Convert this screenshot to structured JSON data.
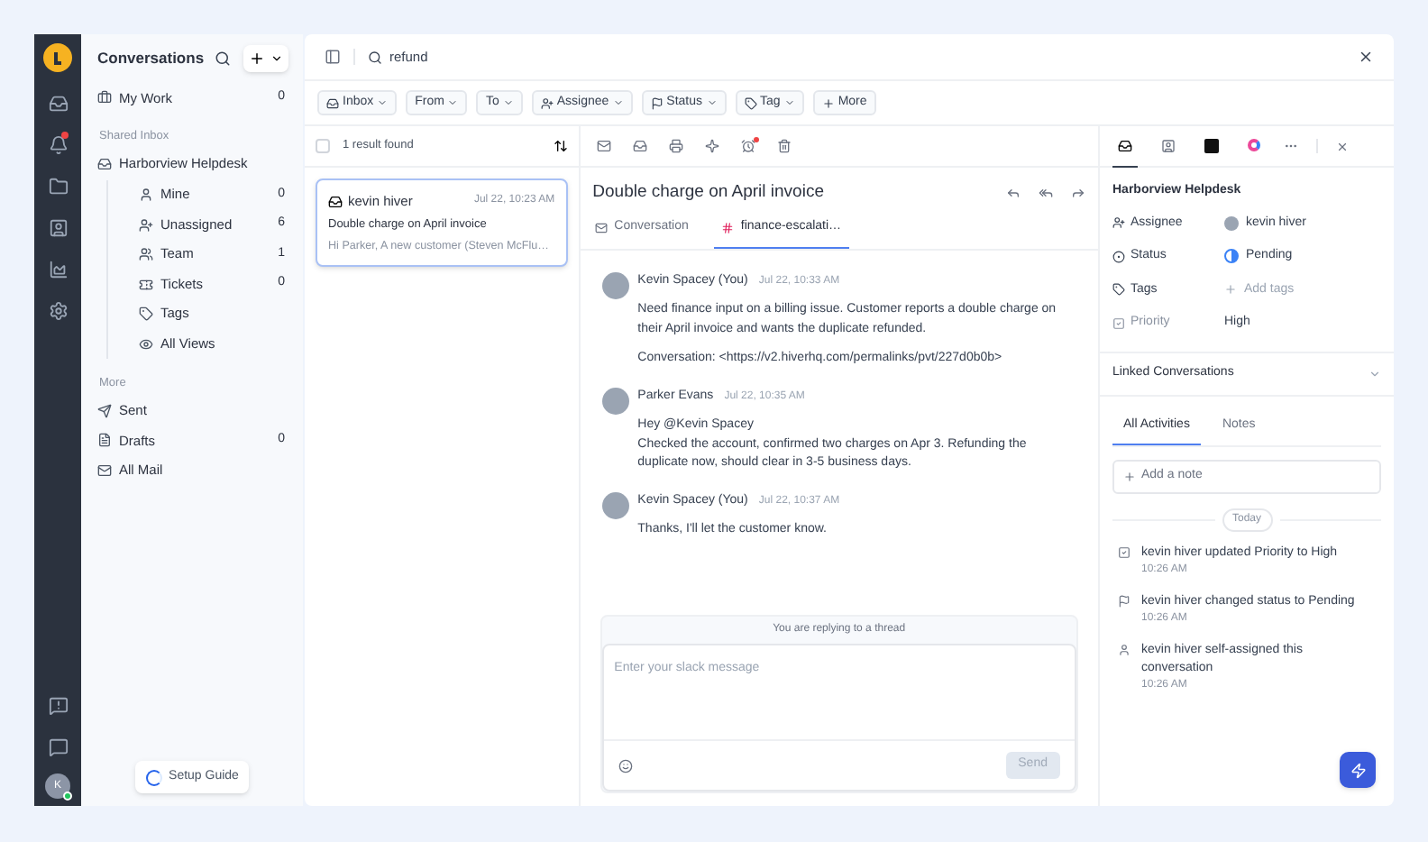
{
  "rail": {
    "top": [
      {
        "kind": "inbox",
        "alert": false
      },
      {
        "kind": "bell",
        "alert": true
      },
      {
        "kind": "folder",
        "alert": false
      },
      {
        "kind": "contact",
        "alert": false
      },
      {
        "kind": "chart",
        "alert": false
      },
      {
        "kind": "settings",
        "alert": false
      }
    ],
    "bottom": [
      {
        "kind": "help",
        "alert": false
      },
      {
        "kind": "chat",
        "alert": false
      }
    ],
    "avatar": {
      "initial": "K",
      "online": true
    }
  },
  "sidebar": {
    "title": "Conversations",
    "sections": [
      {
        "items": [
          {
            "kind": "work",
            "label": "My Work",
            "count": "0"
          }
        ]
      },
      {
        "heading": "Shared Inbox",
        "items": [
          {
            "kind": "inbox",
            "label": "Harborview Helpdesk",
            "children": [
              {
                "kind": "user",
                "label": "Mine",
                "count": "0"
              },
              {
                "kind": "users-plus",
                "label": "Unassigned",
                "count": "6"
              },
              {
                "kind": "team",
                "label": "Team",
                "count": "1"
              },
              {
                "kind": "ticket",
                "label": "Tickets",
                "count": "0"
              },
              {
                "kind": "tag",
                "label": "Tags"
              },
              {
                "kind": "views",
                "label": "All Views"
              }
            ]
          }
        ]
      },
      {
        "heading": "More",
        "items": [
          {
            "kind": "sent",
            "label": "Sent"
          },
          {
            "kind": "draft",
            "label": "Drafts",
            "count": "0"
          },
          {
            "kind": "mail",
            "label": "All Mail"
          }
        ]
      }
    ],
    "setup_guide": "Setup Guide"
  },
  "search": {
    "value": "refund"
  },
  "filters": [
    {
      "kind": "inbox",
      "label": "Inbox"
    },
    {
      "kind": "plain",
      "label": "From"
    },
    {
      "kind": "plain",
      "label": "To"
    },
    {
      "kind": "assignee",
      "label": "Assignee"
    },
    {
      "kind": "status",
      "label": "Status"
    },
    {
      "kind": "tag",
      "label": "Tag"
    },
    {
      "kind": "more",
      "label": "More"
    }
  ],
  "results": {
    "count": "1 result found",
    "all_checked": false,
    "conversations": [
      {
        "from": "kevin hiver",
        "time": "Jul 22, 10:23 AM",
        "subject": "Double charge on April invoice",
        "preview": "Hi Parker, A new customer (Steven McFlu…",
        "selected": true
      }
    ]
  },
  "toolbar": [
    {
      "kind": "mail",
      "alert": false
    },
    {
      "kind": "inbox",
      "alert": false
    },
    {
      "kind": "print",
      "alert": false
    },
    {
      "kind": "sparkle",
      "alert": false
    },
    {
      "kind": "snooze",
      "alert": true
    },
    {
      "kind": "trash",
      "alert": false
    }
  ],
  "thread": {
    "title": "Double charge on April invoice",
    "tabs": [
      {
        "kind": "email",
        "label": "Conversation",
        "selected": false
      },
      {
        "kind": "slack",
        "label": "finance-escalati…",
        "selected": true
      }
    ],
    "messages": [
      {
        "author": "Kevin Spacey (You)",
        "time": "Jul 22, 10:33 AM",
        "paragraphs": [
          "Need finance input on a billing issue. Customer reports a double charge on their April invoice and wants the duplicate refunded.",
          "Conversation: <https://v2.hiverhq.com/permalinks/pvt/227d0b0b>"
        ]
      },
      {
        "author": "Parker Evans",
        "time": "Jul 22, 10:35 AM",
        "paragraphs": [
          "Hey @Kevin Spacey\nChecked the account, confirmed two charges on Apr 3. Refunding the duplicate now, should clear in 3-5 business days."
        ]
      },
      {
        "author": "Kevin Spacey (You)",
        "time": "Jul 22, 10:37 AM",
        "paragraphs": [
          "Thanks, I'll let the customer know."
        ]
      }
    ],
    "reply": {
      "banner": "You are replying to a thread",
      "placeholder": "Enter your slack message",
      "send": {
        "label": "Send",
        "disabled": true
      }
    }
  },
  "details": {
    "tabs": [
      {
        "kind": "inbox",
        "selected": true
      },
      {
        "kind": "contact",
        "selected": false
      },
      {
        "kind": "app-dark",
        "selected": false
      },
      {
        "kind": "app-color",
        "selected": false
      }
    ],
    "inbox": "Harborview Helpdesk",
    "fields": [
      {
        "kind": "assignee",
        "label": "Assignee",
        "value": "kevin hiver"
      },
      {
        "kind": "status",
        "label": "Status",
        "value": "Pending"
      },
      {
        "kind": "tags",
        "label": "Tags",
        "placeholder": "Add tags"
      },
      {
        "kind": "priority",
        "label": "Priority",
        "value": "High"
      }
    ],
    "linked": {
      "title": "Linked Conversations",
      "expanded": false
    },
    "activity_tabs": [
      {
        "label": "All Activities",
        "selected": true
      },
      {
        "label": "Notes",
        "selected": false
      }
    ],
    "note_placeholder": "Add a note",
    "day": "Today",
    "activities": [
      {
        "kind": "priority",
        "text": "kevin hiver updated Priority to High",
        "time": "10:26 AM"
      },
      {
        "kind": "status",
        "text": "kevin hiver changed status to Pending",
        "time": "10:26 AM"
      },
      {
        "kind": "assign",
        "text": "kevin hiver self-assigned this conversation",
        "time": "10:26 AM"
      }
    ]
  }
}
